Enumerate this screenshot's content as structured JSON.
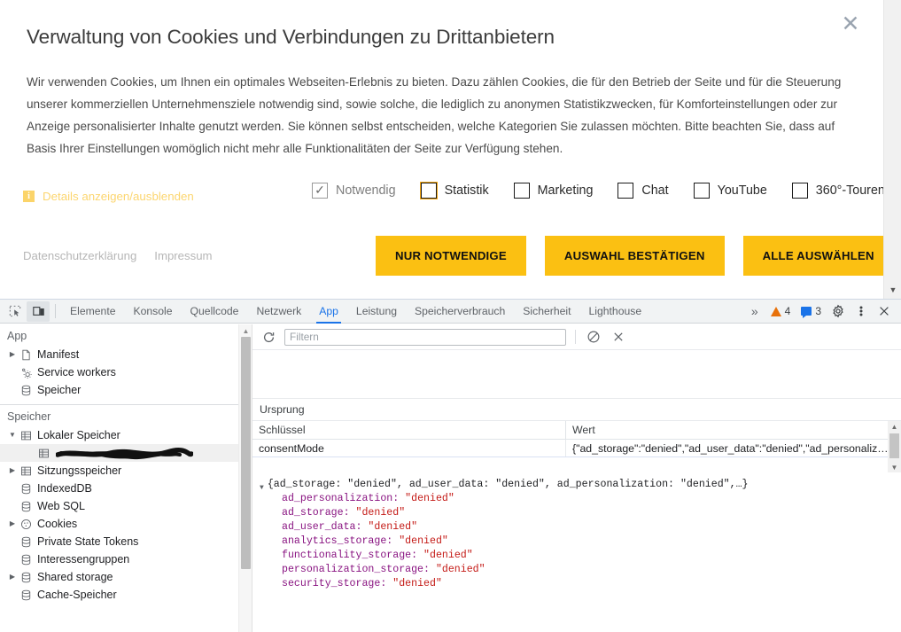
{
  "banner": {
    "title": "Verwaltung von Cookies und Verbindungen zu Drittanbietern",
    "body": "Wir verwenden Cookies, um Ihnen ein optimales Webseiten-Erlebnis zu bieten. Dazu zählen Cookies, die für den Betrieb der Seite und für die Steuerung unserer kommerziellen Unternehmensziele notwendig sind, sowie solche, die lediglich zu anonymen Statistikzwecken, für Komforteinstellungen oder zur Anzeige personalisierter Inhalte genutzt werden. Sie können selbst entscheiden, welche Kategorien Sie zulassen möchten. Bitte beachten Sie, dass auf Basis Ihrer Einstellungen womöglich nicht mehr alle Funktionalitäten der Seite zur Verfügung stehen.",
    "close_icon": "close-icon",
    "details_link": "Details anzeigen/ausblenden",
    "details_icon": "i",
    "accent_yellow": "#fbc012",
    "link_yellow": "#fcd670",
    "checkboxes": [
      {
        "label": "Notwendig",
        "checked": true,
        "disabled": true
      },
      {
        "label": "Statistik",
        "checked": false,
        "disabled": false
      },
      {
        "label": "Marketing",
        "checked": false,
        "disabled": false
      },
      {
        "label": "Chat",
        "checked": false,
        "disabled": false
      },
      {
        "label": "YouTube",
        "checked": false,
        "disabled": false
      },
      {
        "label": "360°-Touren",
        "checked": false,
        "disabled": false
      }
    ],
    "footer_links": [
      {
        "label": "Datenschutzerklärung"
      },
      {
        "label": "Impressum"
      }
    ],
    "buttons": [
      {
        "label": "NUR NOTWENDIGE"
      },
      {
        "label": "AUSWAHL BESTÄTIGEN"
      },
      {
        "label": "ALLE AUSWÄHLEN"
      }
    ]
  },
  "devtools": {
    "left_icons": [
      {
        "name": "inspect-element-icon"
      },
      {
        "name": "device-toolbar-icon"
      }
    ],
    "tabs": [
      {
        "label": "Elemente",
        "selected": false
      },
      {
        "label": "Konsole",
        "selected": false
      },
      {
        "label": "Quellcode",
        "selected": false
      },
      {
        "label": "Netzwerk",
        "selected": false
      },
      {
        "label": "App",
        "selected": true
      },
      {
        "label": "Leistung",
        "selected": false
      },
      {
        "label": "Speicherverbrauch",
        "selected": false
      },
      {
        "label": "Sicherheit",
        "selected": false
      },
      {
        "label": "Lighthouse",
        "selected": false
      }
    ],
    "more_tabs_icon": "»",
    "warnings_count": "4",
    "messages_count": "3",
    "settings_icon": "gear-icon",
    "kebab_icon": "more-options-icon",
    "close_icon": "close-icon",
    "sidebar": {
      "sections": [
        {
          "title": "App",
          "items": [
            {
              "label": "Manifest",
              "icon": "document-icon",
              "expandable": true,
              "expanded": false,
              "indent": 1,
              "selected": false
            },
            {
              "label": "Service workers",
              "icon": "gears-icon",
              "expandable": false,
              "expanded": false,
              "indent": 1,
              "selected": false
            },
            {
              "label": "Speicher",
              "icon": "database-icon",
              "expandable": false,
              "expanded": false,
              "indent": 1,
              "selected": false
            }
          ]
        },
        {
          "title": "Speicher",
          "items": [
            {
              "label": "Lokaler Speicher",
              "icon": "table-icon",
              "expandable": true,
              "expanded": true,
              "indent": 1,
              "selected": false
            },
            {
              "label": "",
              "icon": "table-icon",
              "expandable": false,
              "expanded": false,
              "indent": 2,
              "selected": true,
              "redacted": true
            },
            {
              "label": "Sitzungsspeicher",
              "icon": "table-icon",
              "expandable": true,
              "expanded": false,
              "indent": 1,
              "selected": false
            },
            {
              "label": "IndexedDB",
              "icon": "database-icon",
              "expandable": false,
              "expanded": false,
              "indent": 1,
              "selected": false
            },
            {
              "label": "Web SQL",
              "icon": "database-icon",
              "expandable": false,
              "expanded": false,
              "indent": 1,
              "selected": false
            },
            {
              "label": "Cookies",
              "icon": "cookie-icon",
              "expandable": true,
              "expanded": false,
              "indent": 1,
              "selected": false
            },
            {
              "label": "Private State Tokens",
              "icon": "database-icon",
              "expandable": false,
              "expanded": false,
              "indent": 1,
              "selected": false
            },
            {
              "label": "Interessengruppen",
              "icon": "database-icon",
              "expandable": false,
              "expanded": false,
              "indent": 1,
              "selected": false
            },
            {
              "label": "Shared storage",
              "icon": "database-icon",
              "expandable": true,
              "expanded": false,
              "indent": 1,
              "selected": false
            },
            {
              "label": "Cache-Speicher",
              "icon": "database-icon",
              "expandable": false,
              "expanded": false,
              "indent": 1,
              "selected": false
            }
          ]
        }
      ]
    },
    "main": {
      "refresh_icon": "refresh-icon",
      "filter_placeholder": "Filtern",
      "filter_value": "",
      "clear_filter_icon": "block-icon",
      "delete_icon": "close-icon",
      "origin_label": "Ursprung",
      "table": {
        "columns": [
          "Schlüssel",
          "Wert"
        ],
        "rows": [
          {
            "key": "consentMode",
            "value": "{\"ad_storage\":\"denied\",\"ad_user_data\":\"denied\",\"ad_personaliz…"
          }
        ]
      },
      "preview": {
        "summary": "{ad_storage: \"denied\", ad_user_data: \"denied\", ad_personalization: \"denied\",…}",
        "entries": [
          {
            "key": "ad_personalization",
            "value": "\"denied\""
          },
          {
            "key": "ad_storage",
            "value": "\"denied\""
          },
          {
            "key": "ad_user_data",
            "value": "\"denied\""
          },
          {
            "key": "analytics_storage",
            "value": "\"denied\""
          },
          {
            "key": "functionality_storage",
            "value": "\"denied\""
          },
          {
            "key": "personalization_storage",
            "value": "\"denied\""
          },
          {
            "key": "security_storage",
            "value": "\"denied\""
          }
        ]
      }
    }
  }
}
